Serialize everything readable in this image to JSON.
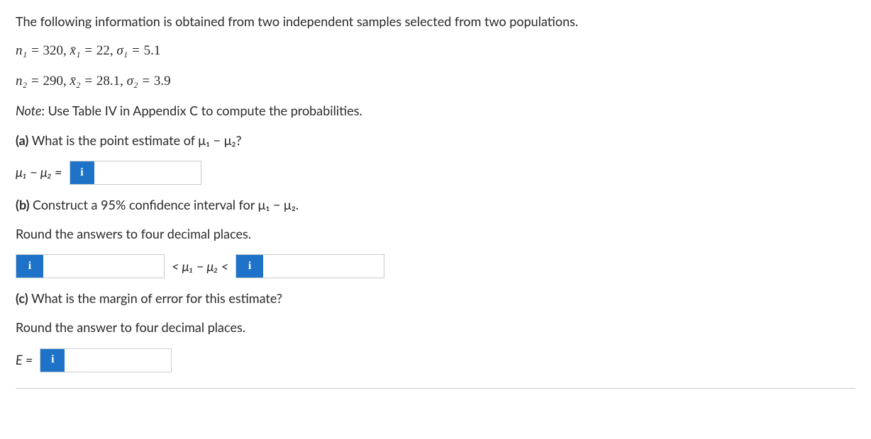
{
  "intro": "The following information is obtained from two independent samples selected from two populations.",
  "sample1": {
    "n_lhs": "n₁ = ",
    "n_val": "320,",
    "xbar_lbl": " x̄₁ = ",
    "xbar_val": "22,",
    "sigma_lbl": " σ₁ = ",
    "sigma_val": "5.1"
  },
  "sample2": {
    "n_lhs": "n₂ = ",
    "n_val": "290,",
    "xbar_lbl": " x̄₂ = ",
    "xbar_val": "28.1,",
    "sigma_lbl": " σ₂ = ",
    "sigma_val": "3.9"
  },
  "note_prefix": "Note",
  "note_body": ": Use Table IV in Appendix C to compute the probabilities.",
  "partA": {
    "tag": "(a) ",
    "question": "What is the point estimate of μ₁ − μ₂?",
    "label": "μ₁ − μ₂ = "
  },
  "partB": {
    "tag": "(b) ",
    "question": "Construct a 95% confidence interval for μ₁ − μ₂.",
    "hint": "Round the answers to four decimal places.",
    "mid": " < μ₁ − μ₂ < "
  },
  "partC": {
    "tag": "(c) ",
    "question": "What is the margin of error for this estimate?",
    "hint": "Round the answer to four decimal places.",
    "label": "E = "
  },
  "info_glyph": "i"
}
